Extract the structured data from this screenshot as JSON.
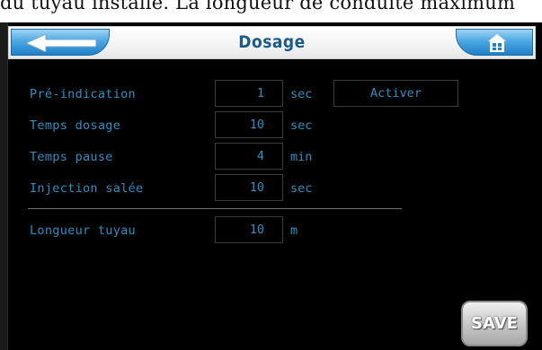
{
  "caption": "du tuyau installé. La longueur  de conduite maximum",
  "header": {
    "title": "Dosage",
    "back_icon": "back-arrow-icon",
    "home_icon": "home-icon"
  },
  "rows": [
    {
      "label": "Pré-indication",
      "value": "1",
      "unit": "sec"
    },
    {
      "label": "Temps dosage",
      "value": "10",
      "unit": "sec"
    },
    {
      "label": "Temps pause",
      "value": "4",
      "unit": "min"
    },
    {
      "label": "Injection salée",
      "value": "10",
      "unit": "sec"
    }
  ],
  "activate_label": "Activer",
  "hose": {
    "label": "Longueur tuyau",
    "value": "10",
    "unit": "m"
  },
  "save_label": "SAVE",
  "colors": {
    "screen_bg": "#000000",
    "text": "#2f8fc2",
    "title": "#1c5a8c",
    "button_blue": "#4da8e3"
  }
}
